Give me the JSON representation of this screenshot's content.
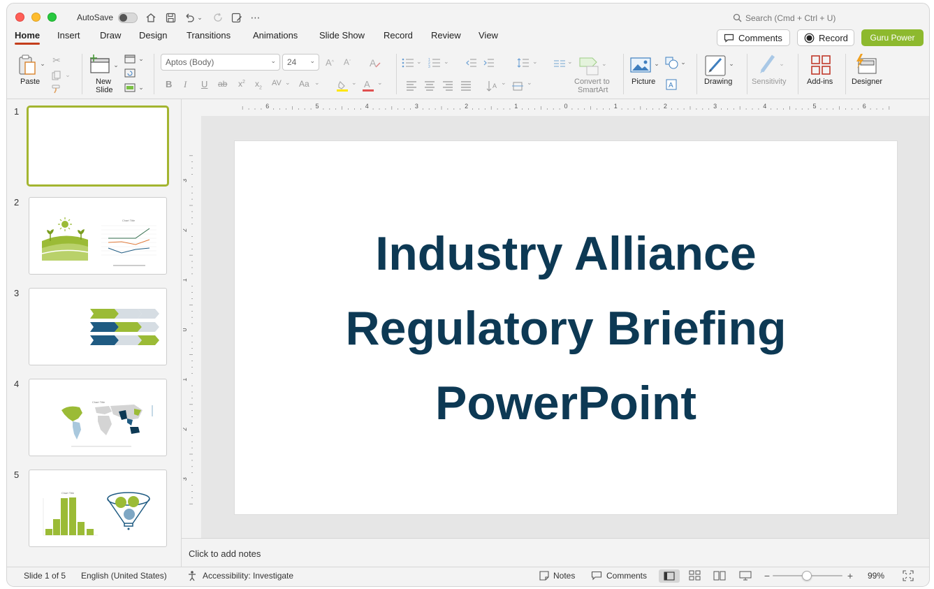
{
  "window": {
    "autosave_label": "AutoSave",
    "search_placeholder": "Search (Cmd + Ctrl + U)"
  },
  "tabs": [
    "Home",
    "Insert",
    "Draw",
    "Design",
    "Transitions",
    "Animations",
    "Slide Show",
    "Record",
    "Review",
    "View"
  ],
  "header_buttons": {
    "comments": "Comments",
    "record": "Record",
    "guru": "Guru Power"
  },
  "ribbon": {
    "paste": "Paste",
    "new_slide_line1": "New",
    "new_slide_line2": "Slide",
    "font_name": "Aptos (Body)",
    "font_size": "24",
    "convert_line1": "Convert to",
    "convert_line2": "SmartArt",
    "picture": "Picture",
    "drawing": "Drawing",
    "sensitivity": "Sensitivity",
    "addins": "Add-ins",
    "designer": "Designer"
  },
  "ruler": {
    "h_labels": [
      "6",
      "5",
      "4",
      "3",
      "2",
      "1",
      "0",
      "1",
      "2",
      "3",
      "4",
      "5",
      "6"
    ],
    "v_labels": [
      "3",
      "2",
      "1",
      "0",
      "1",
      "2",
      "3"
    ]
  },
  "slides": [
    {
      "number": "1"
    },
    {
      "number": "2",
      "chart_title": "Chart Title"
    },
    {
      "number": "3"
    },
    {
      "number": "4",
      "chart_title": "Chart Title"
    },
    {
      "number": "5",
      "chart_title": "Chart Title"
    }
  ],
  "slide": {
    "title_line1": "Industry Alliance",
    "title_line2": "Regulatory Briefing",
    "title_line3": "PowerPoint",
    "title_color": "#0d3954"
  },
  "notes_placeholder": "Click to add notes",
  "statusbar": {
    "slide_indicator": "Slide 1 of 5",
    "language": "English (United States)",
    "accessibility": "Accessibility: Investigate",
    "notes": "Notes",
    "comments": "Comments",
    "zoom": "99%"
  },
  "colors": {
    "accent_tab": "#c43e1c",
    "guru_green": "#8db92e",
    "lime": "#9bbb36",
    "navy": "#1f5b82"
  }
}
